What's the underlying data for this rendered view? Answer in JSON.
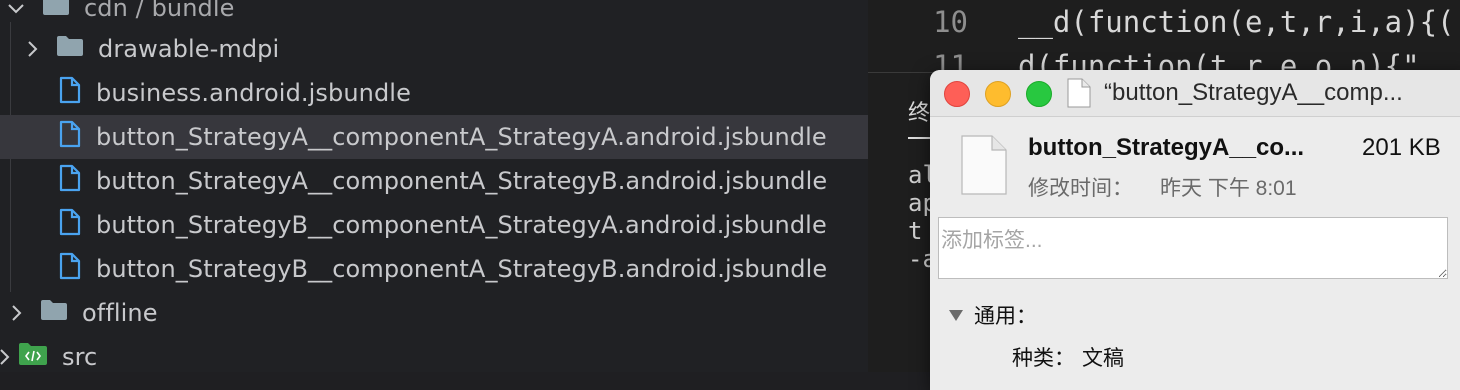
{
  "explorer": {
    "rows": [
      {
        "label": "cdn / bundle"
      },
      {
        "label": "drawable-mdpi"
      },
      {
        "label": "business.android.jsbundle"
      },
      {
        "label": "button_StrategyA__componentA_StrategyA.android.jsbundle"
      },
      {
        "label": "button_StrategyA__componentA_StrategyB.android.jsbundle"
      },
      {
        "label": "button_StrategyB__componentA_StrategyA.android.jsbundle"
      },
      {
        "label": "button_StrategyB__componentA_StrategyB.android.jsbundle"
      },
      {
        "label": "offline"
      },
      {
        "label": "src"
      }
    ]
  },
  "editor": {
    "lines": [
      {
        "number": "10",
        "code": "__d(function(e,t,r,i,a){("
      },
      {
        "number": "11",
        "code": "  d(function(t,r,e,o,n){\""
      }
    ],
    "terminal": {
      "tab_label": "终",
      "lines": [
        "al",
        "ap",
        "t",
        "-a"
      ]
    }
  },
  "info_window": {
    "title": "“button_StrategyA__comp...",
    "file_name": "button_StrategyA__co...",
    "file_size": "201 KB",
    "modified_label": "修改时间：",
    "modified_value": "昨天 下午 8:01",
    "tags_placeholder": "添加标签...",
    "general_label": "通用：",
    "kind_label": "种类：",
    "kind_value": "文稿"
  },
  "colors": {
    "folder_icon": "#90a4ae",
    "file_icon": "#4aa3f0",
    "src_folder_icon": "#3fa34d",
    "selection": "#37373d"
  }
}
